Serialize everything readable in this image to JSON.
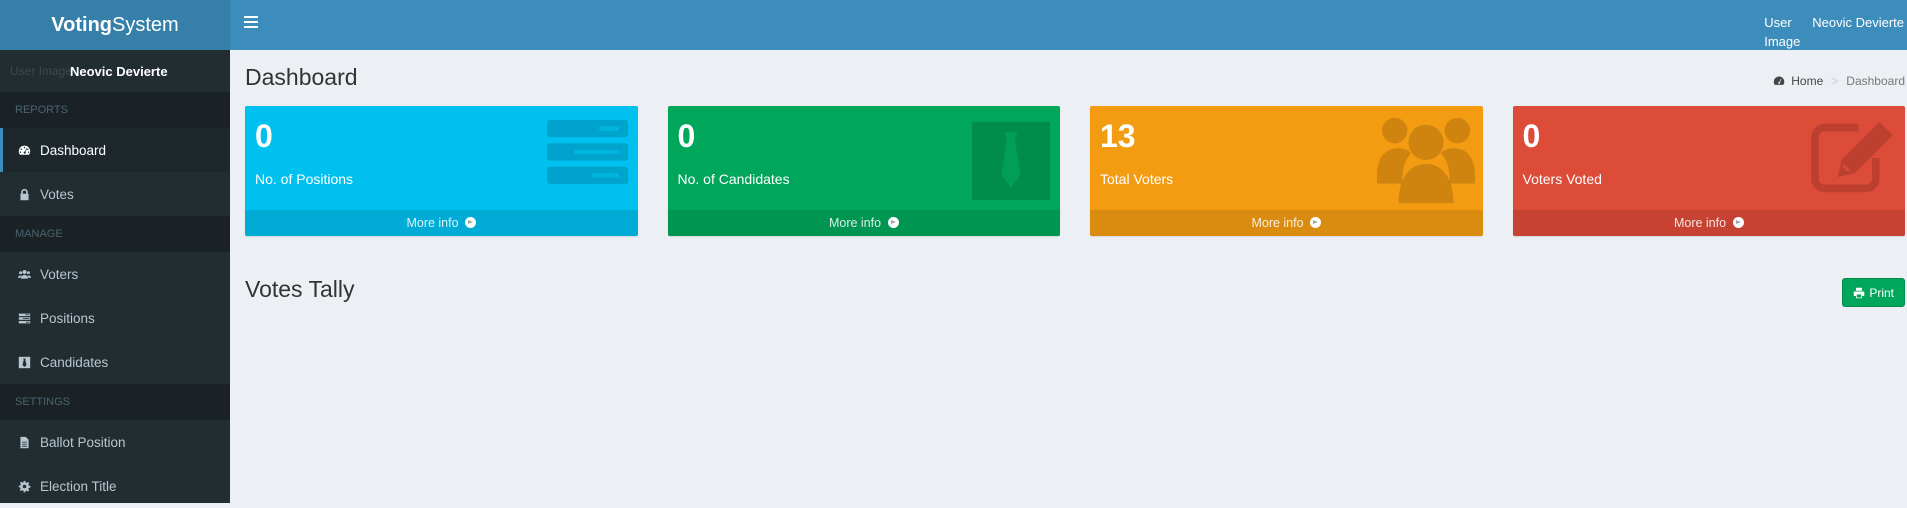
{
  "app": {
    "logo_bold": "Voting",
    "logo_rest": "System"
  },
  "topbar": {
    "user_image_alt": "User Image",
    "user_name": "Neovic Devierte"
  },
  "sidebar": {
    "user_image_alt": "User Image",
    "user_name": "Neovic Devierte",
    "sections": [
      {
        "header": "REPORTS",
        "items": [
          {
            "label": "Dashboard",
            "icon": "dashboard-icon"
          },
          {
            "label": "Votes",
            "icon": "lock-icon"
          }
        ]
      },
      {
        "header": "MANAGE",
        "items": [
          {
            "label": "Voters",
            "icon": "users-icon"
          },
          {
            "label": "Positions",
            "icon": "tasks-icon"
          },
          {
            "label": "Candidates",
            "icon": "black-tie-icon"
          }
        ]
      },
      {
        "header": "SETTINGS",
        "items": [
          {
            "label": "Ballot Position",
            "icon": "file-text-icon"
          },
          {
            "label": "Election Title",
            "icon": "cog-icon"
          }
        ]
      }
    ],
    "active_item": "Dashboard"
  },
  "content": {
    "page_title": "Dashboard",
    "breadcrumb": {
      "home": "Home",
      "current": "Dashboard"
    },
    "stat_boxes": [
      {
        "value": "0",
        "label": "No. of Positions",
        "more": "More info",
        "color": "#00c0ef",
        "icon": "tasks-icon"
      },
      {
        "value": "0",
        "label": "No. of Candidates",
        "more": "More info",
        "color": "#00a65a",
        "icon": "black-tie-icon"
      },
      {
        "value": "13",
        "label": "Total Voters",
        "more": "More info",
        "color": "#f39c12",
        "icon": "users-icon"
      },
      {
        "value": "0",
        "label": "Voters Voted",
        "more": "More info",
        "color": "#dd4b39",
        "icon": "edit-icon"
      }
    ],
    "tally_title": "Votes Tally",
    "print_label": "Print"
  },
  "colors": {
    "topbar": "#3c8dbc",
    "logo": "#367fa9",
    "sidebar": "#222d32",
    "content_bg": "#ecf0f5",
    "print_button": "#00a65a"
  }
}
